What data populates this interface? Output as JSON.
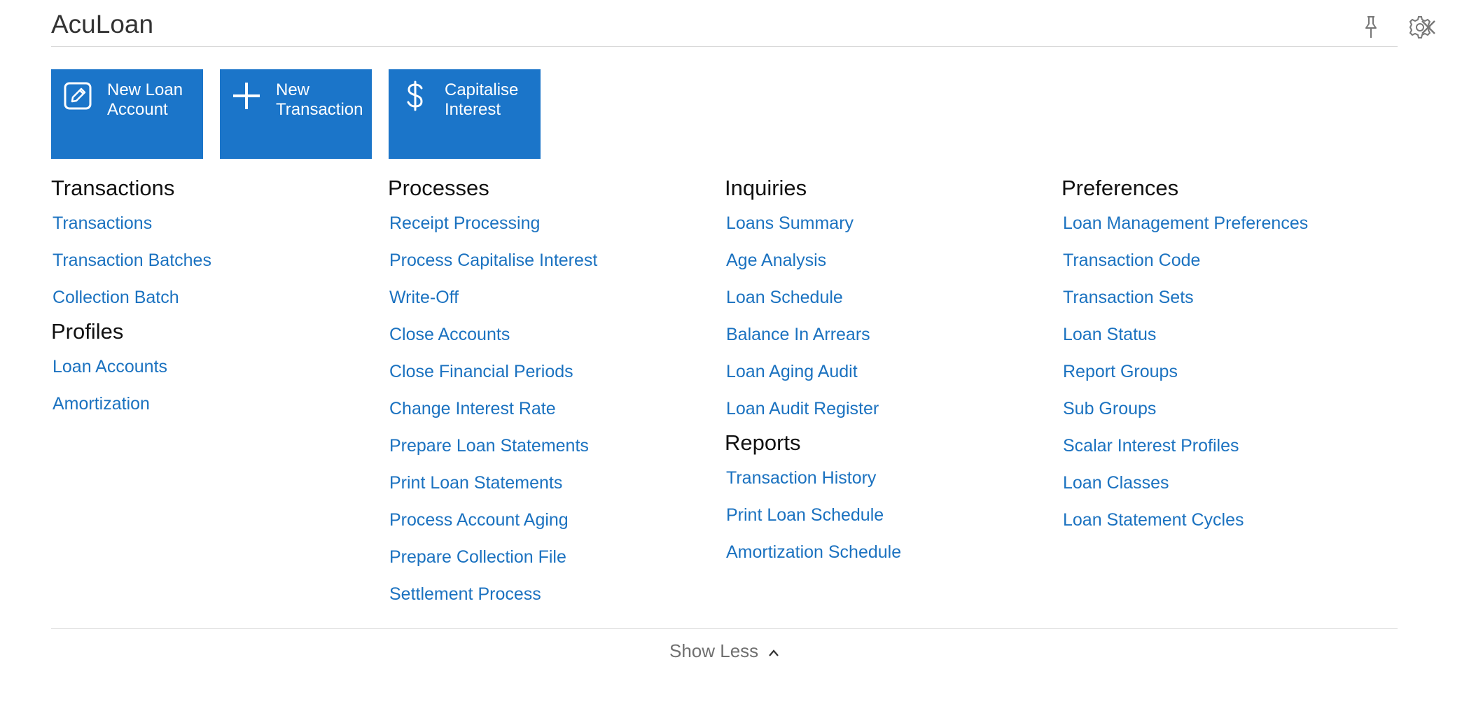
{
  "header": {
    "title": "AcuLoan",
    "icons": [
      "pin-icon",
      "gear-icon",
      "close-icon"
    ]
  },
  "tiles": [
    {
      "label": "New Loan Account",
      "icon": "edit-icon"
    },
    {
      "label": "New Transaction",
      "icon": "plus-icon"
    },
    {
      "label": "Capitalise Interest",
      "icon": "dollar-icon"
    }
  ],
  "columns": {
    "transactions": {
      "title": "Transactions",
      "items": [
        "Transactions",
        "Transaction Batches",
        "Collection Batch"
      ]
    },
    "profiles": {
      "title": "Profiles",
      "items": [
        "Loan Accounts",
        "Amortization"
      ]
    },
    "processes": {
      "title": "Processes",
      "items": [
        "Receipt Processing",
        "Process Capitalise Interest",
        "Write-Off",
        "Close Accounts",
        "Close Financial Periods",
        "Change Interest Rate",
        "Prepare Loan Statements",
        "Print Loan Statements",
        "Process Account Aging",
        "Prepare Collection File",
        "Settlement Process"
      ]
    },
    "inquiries": {
      "title": "Inquiries",
      "items": [
        "Loans Summary",
        "Age Analysis",
        "Loan Schedule",
        "Balance In Arrears",
        "Loan Aging Audit",
        "Loan Audit Register"
      ]
    },
    "reports": {
      "title": "Reports",
      "items": [
        "Transaction History",
        "Print Loan Schedule",
        "Amortization Schedule"
      ]
    },
    "preferences": {
      "title": "Preferences",
      "items": [
        "Loan Management Preferences",
        "Transaction Code",
        "Transaction Sets",
        "Loan Status",
        "Report Groups",
        "Sub Groups",
        "Scalar Interest Profiles",
        "Loan Classes",
        "Loan Statement Cycles"
      ]
    }
  },
  "footer": {
    "show_less_label": "Show Less"
  },
  "colors": {
    "accent": "#1b75c9",
    "link": "#1b72c0",
    "muted": "#707070"
  }
}
